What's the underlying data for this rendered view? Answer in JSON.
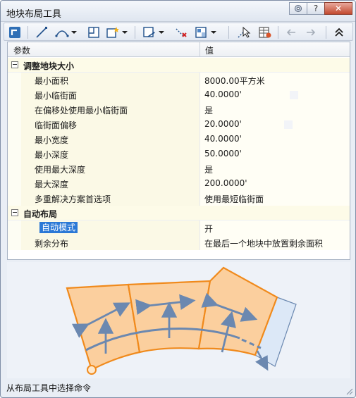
{
  "window": {
    "title": "地块布局工具",
    "buttons": {
      "help": "?",
      "close": "✕"
    }
  },
  "toolbar": {
    "items": [
      {
        "name": "select-icon"
      },
      {
        "name": "line-icon"
      },
      {
        "name": "arc-icon"
      },
      {
        "name": "polygon-icon"
      },
      {
        "name": "new-object-icon"
      },
      {
        "name": "frontage-icon"
      },
      {
        "name": "delete-vertex-icon"
      },
      {
        "name": "layout-icon"
      },
      {
        "name": "pick-icon"
      },
      {
        "name": "table-icon"
      },
      {
        "name": "undo-icon"
      },
      {
        "name": "redo-icon"
      },
      {
        "name": "collapse-icon"
      }
    ]
  },
  "grid": {
    "header": {
      "param": "参数",
      "value": "值"
    },
    "categories": [
      {
        "label": "调整地块大小",
        "rows": [
          {
            "label": "最小面积",
            "value": "8000.00平方米"
          },
          {
            "label": "最小临街面",
            "value": "40.0000'"
          },
          {
            "label": "在偏移处使用最小临街面",
            "value": "是"
          },
          {
            "label": "临街面偏移",
            "value": "20.0000'"
          },
          {
            "label": "最小宽度",
            "value": "40.0000'"
          },
          {
            "label": "最小深度",
            "value": "50.0000'"
          },
          {
            "label": "使用最大深度",
            "value": "是"
          },
          {
            "label": "最大深度",
            "value": "200.0000'"
          },
          {
            "label": "多重解决方案首选项",
            "value": "使用最短临街面"
          }
        ]
      },
      {
        "label": "自动布局",
        "rows": [
          {
            "label": "自动模式",
            "value": "开"
          },
          {
            "label": "剩余分布",
            "value": "在最后一个地块中放置剩余面积"
          }
        ]
      }
    ]
  },
  "status": "从布局工具中选择命令",
  "colors": {
    "parcel_fill": "#fbcf9e",
    "parcel_stroke": "#f08a1c",
    "remainder_fill": "#dce8f7",
    "arrow": "#6b88b0",
    "selection": "#2b78d6"
  }
}
